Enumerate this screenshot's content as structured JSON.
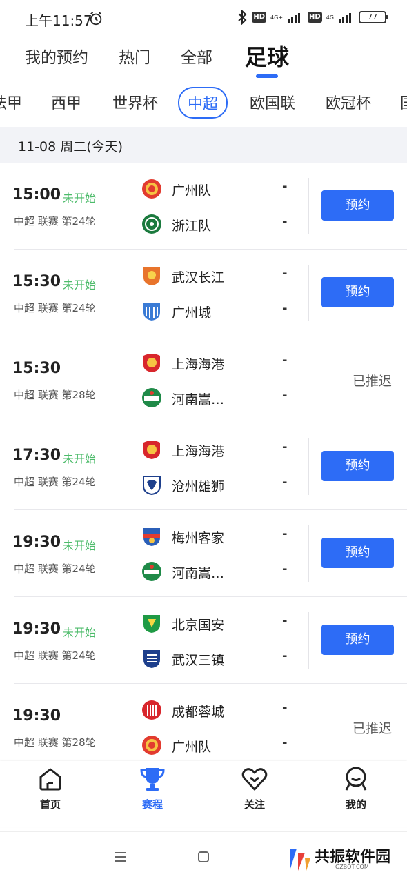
{
  "status_bar": {
    "time": "上午11:57",
    "net1": "4G+",
    "net2": "4G",
    "hd": "HD",
    "battery": "77"
  },
  "top_tabs": [
    {
      "label": "我的预约",
      "active": false
    },
    {
      "label": "热门",
      "active": false
    },
    {
      "label": "全部",
      "active": false
    },
    {
      "label": "足球",
      "active": true
    }
  ],
  "league_tabs": [
    {
      "label": "法甲",
      "active": false
    },
    {
      "label": "西甲",
      "active": false
    },
    {
      "label": "世界杯",
      "active": false
    },
    {
      "label": "中超",
      "active": true
    },
    {
      "label": "欧国联",
      "active": false
    },
    {
      "label": "欧冠杯",
      "active": false
    },
    {
      "label": "国",
      "active": false
    }
  ],
  "date_header": "11-08 周二(今天)",
  "matches": [
    {
      "time": "15:00",
      "status": "未开始",
      "meta": "中超 联赛  第24轮",
      "home": {
        "name": "广州队",
        "score": "-",
        "logo": "guangzhou-fc-logo"
      },
      "away": {
        "name": "浙江队",
        "score": "-",
        "logo": "zhejiang-fc-logo"
      },
      "action": "预约",
      "action_type": "button"
    },
    {
      "time": "15:30",
      "status": "未开始",
      "meta": "中超 联赛  第24轮",
      "home": {
        "name": "武汉长江",
        "score": "-",
        "logo": "wuhan-yangtze-logo"
      },
      "away": {
        "name": "广州城",
        "score": "-",
        "logo": "guangzhou-city-logo"
      },
      "action": "预约",
      "action_type": "button"
    },
    {
      "time": "15:30",
      "status": "",
      "meta": "中超 联赛  第28轮",
      "home": {
        "name": "上海海港",
        "score": "-",
        "logo": "shanghai-port-logo"
      },
      "away": {
        "name": "河南嵩…",
        "score": "-",
        "logo": "henan-songshan-logo"
      },
      "action": "已推迟",
      "action_type": "text"
    },
    {
      "time": "17:30",
      "status": "未开始",
      "meta": "中超 联赛  第24轮",
      "home": {
        "name": "上海海港",
        "score": "-",
        "logo": "shanghai-port-logo"
      },
      "away": {
        "name": "沧州雄狮",
        "score": "-",
        "logo": "cangzhou-lions-logo"
      },
      "action": "预约",
      "action_type": "button"
    },
    {
      "time": "19:30",
      "status": "未开始",
      "meta": "中超 联赛  第24轮",
      "home": {
        "name": "梅州客家",
        "score": "-",
        "logo": "meizhou-hakka-logo"
      },
      "away": {
        "name": "河南嵩…",
        "score": "-",
        "logo": "henan-songshan-logo"
      },
      "action": "预约",
      "action_type": "button"
    },
    {
      "time": "19:30",
      "status": "未开始",
      "meta": "中超 联赛  第24轮",
      "home": {
        "name": "北京国安",
        "score": "-",
        "logo": "beijing-guoan-logo"
      },
      "away": {
        "name": "武汉三镇",
        "score": "-",
        "logo": "wuhan-three-towns-logo"
      },
      "action": "预约",
      "action_type": "button"
    },
    {
      "time": "19:30",
      "status": "",
      "meta": "中超 联赛  第28轮",
      "home": {
        "name": "成都蓉城",
        "score": "-",
        "logo": "chengdu-rongcheng-logo"
      },
      "away": {
        "name": "广州队",
        "score": "-",
        "logo": "guangzhou-fc-logo"
      },
      "action": "已推迟",
      "action_type": "text"
    }
  ],
  "bottom_nav": [
    {
      "label": "首页",
      "icon": "home-icon",
      "active": false
    },
    {
      "label": "赛程",
      "icon": "trophy-icon",
      "active": true
    },
    {
      "label": "关注",
      "icon": "heart-icon",
      "active": false
    },
    {
      "label": "我的",
      "icon": "profile-icon",
      "active": false
    }
  ],
  "watermark": {
    "text": "共振软件园",
    "sub": "GZBQT.COM"
  },
  "colors": {
    "accent": "#2d6cf6",
    "status_green": "#4cbb6a",
    "date_bg": "#f2f3f7"
  }
}
